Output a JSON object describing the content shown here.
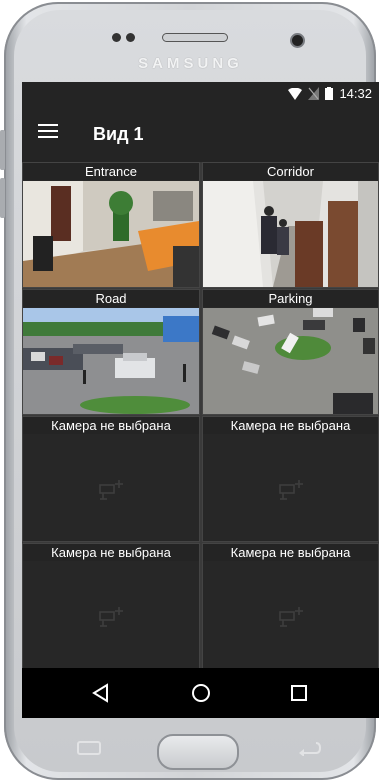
{
  "device": {
    "brand": "SAMSUNG"
  },
  "statusbar": {
    "time": "14:32",
    "icons": [
      "wifi-icon",
      "no-sim-icon",
      "battery-icon"
    ]
  },
  "toolbar": {
    "title": "Вид 1",
    "menu_icon": "hamburger-menu-icon"
  },
  "cameras": [
    {
      "label": "Entrance",
      "state": "live"
    },
    {
      "label": "Corridor",
      "state": "live"
    },
    {
      "label": "Road",
      "state": "live"
    },
    {
      "label": "Parking",
      "state": "live"
    },
    {
      "label": "Камера не выбрана",
      "state": "empty",
      "icon": "add-camera-icon"
    },
    {
      "label": "Камера не выбрана",
      "state": "empty",
      "icon": "add-camera-icon"
    },
    {
      "label": "Камера не выбрана",
      "state": "empty",
      "icon": "add-camera-icon"
    },
    {
      "label": "Камера не выбрана",
      "state": "empty",
      "icon": "add-camera-icon"
    }
  ],
  "navbar": {
    "icons": [
      "back-icon",
      "home-icon",
      "recents-icon"
    ]
  },
  "colors": {
    "screen_bg": "#242424",
    "cell_border": "#444444",
    "navbar_bg": "#000000"
  }
}
